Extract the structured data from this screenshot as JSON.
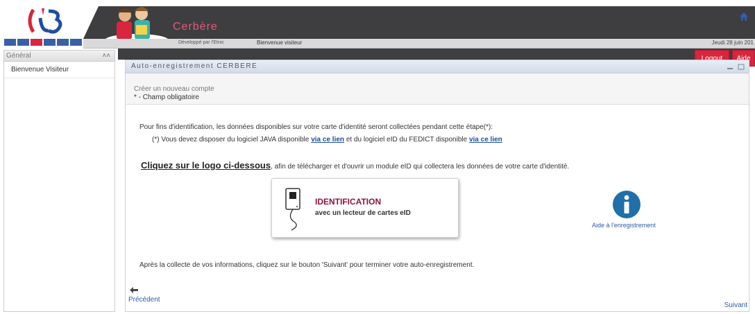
{
  "header": {
    "brand_title": "Cerbère",
    "developed_by": "Développé par l'Etnic",
    "welcome": "Bienvenue visiteur",
    "date": "Jeudi 28 juin 201",
    "logout_label": "Logout",
    "help_label": "Aide"
  },
  "sidebar": {
    "section_title": "Général",
    "items": [
      {
        "label": "Bienvenue Visiteur"
      }
    ]
  },
  "panel": {
    "title": "Auto-enregistrement CERBERE",
    "create_account": "Créer un nouveau compte",
    "required_note": "* - Champ obligatoire"
  },
  "content": {
    "intro": "Pour fins d'identification, les données disponibles sur votre carte d'identité seront collectées pendant cette étape(*):",
    "req_prefix": "(*) Vous devez disposer du logiciel JAVA disponible",
    "link1": "via ce lien",
    "req_middle": "et du logiciel eID du FEDICT disponible",
    "link2": "via ce lien",
    "click_strong": "Cliquez sur le logo ci-dessous",
    "click_rest": ", afin de télécharger et d'ouvrir un module eID qui collectera les données de votre carte d'identité.",
    "id_title": "IDENTIFICATION",
    "id_subtitle": "avec un lecteur de cartes eID",
    "help_link": "Aide à l'enregistrement",
    "after": "Après la collecte de vos informations, cliquez sur le bouton 'Suivant' pour terminer votre auto-enregistrement.",
    "previous": "Précédent",
    "next": "Suivant"
  },
  "colors": {
    "accent_red": "#d7263d",
    "header_dark": "#3e3e40",
    "brand_pink": "#e45a7a",
    "link_blue": "#2a5ca8",
    "info_blue": "#1f6fa8"
  }
}
